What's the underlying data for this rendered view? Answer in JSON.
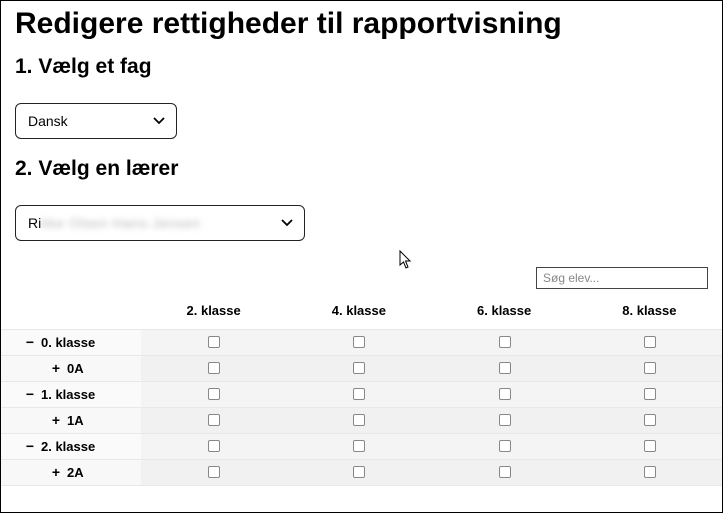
{
  "title": "Redigere rettigheder til rapportvisning",
  "step1": {
    "heading": "1. Vælg et fag",
    "select_value": "Dansk"
  },
  "step2": {
    "heading": "2. Vælg en lærer",
    "select_prefix": "Ri",
    "select_blurred": "kke Olsen Hans-Jensen"
  },
  "search": {
    "placeholder": "Søg elev..."
  },
  "table": {
    "columns": [
      "2. klasse",
      "4. klasse",
      "6. klasse",
      "8. klasse"
    ],
    "rows": [
      {
        "label": "0. klasse",
        "depth": 0,
        "expanded": true
      },
      {
        "label": "0A",
        "depth": 1,
        "expanded": false
      },
      {
        "label": "1. klasse",
        "depth": 0,
        "expanded": true
      },
      {
        "label": "1A",
        "depth": 1,
        "expanded": false
      },
      {
        "label": "2. klasse",
        "depth": 0,
        "expanded": true
      },
      {
        "label": "2A",
        "depth": 1,
        "expanded": false
      }
    ]
  }
}
